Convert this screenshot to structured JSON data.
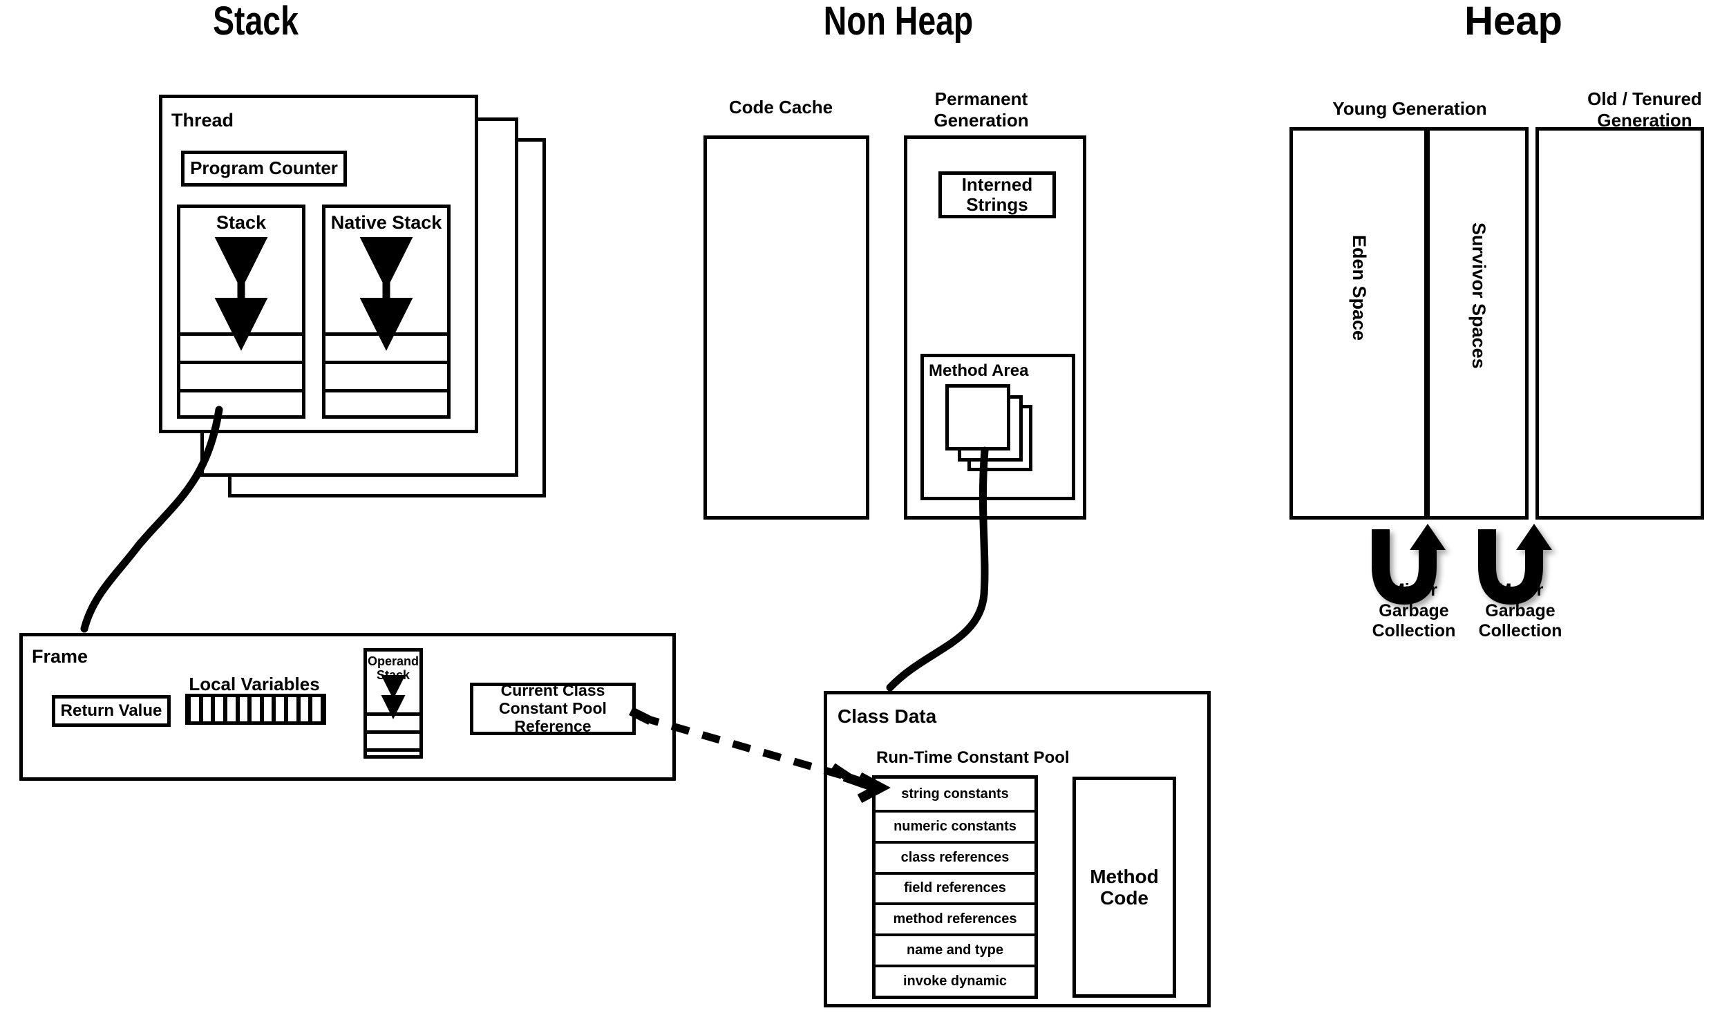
{
  "sections": [
    {
      "id": "stack",
      "title": "Stack"
    },
    {
      "id": "non_heap",
      "title": "Non Heap"
    },
    {
      "id": "heap",
      "title": "Heap"
    }
  ],
  "stack": {
    "thread": {
      "label": "Thread",
      "program_counter": "Program Counter",
      "stacks": [
        {
          "label": "Stack",
          "frame_slots": 3
        },
        {
          "label": "Native Stack",
          "frame_slots": 3
        }
      ],
      "stacked_copies": 3
    },
    "frame": {
      "label": "Frame",
      "return_value": "Return Value",
      "local_variables": {
        "label": "Local Variables",
        "cells": 11
      },
      "operand_stack": {
        "label": "Operand\nStack",
        "slots": 3
      },
      "constant_pool_reference": "Current Class\nConstant Pool\nReference"
    }
  },
  "non_heap": {
    "code_cache": {
      "label": "Code Cache"
    },
    "permanent_generation": {
      "label": "Permanent\nGeneration",
      "interned_strings": "Interned\nStrings",
      "method_area": {
        "label": "Method Area",
        "class_boxes": 3
      }
    },
    "class_data": {
      "label": "Class Data",
      "run_time_constant_pool": {
        "label": "Run-Time Constant Pool",
        "entries": [
          "string constants",
          "numeric constants",
          "class references",
          "field references",
          "method references",
          "name and type",
          "invoke dynamic"
        ]
      },
      "method_code": "Method\nCode"
    }
  },
  "heap": {
    "young_generation": {
      "label": "Young Generation",
      "spaces": [
        "Eden Space",
        "Survivor Spaces"
      ]
    },
    "old_generation": {
      "label": "Old / Tenured\nGeneration"
    },
    "garbage_collection": [
      "Minor\nGarbage\nCollection",
      "Major\nGarbage\nCollection"
    ]
  },
  "colors": {
    "stroke": "#000000",
    "background": "#ffffff"
  }
}
